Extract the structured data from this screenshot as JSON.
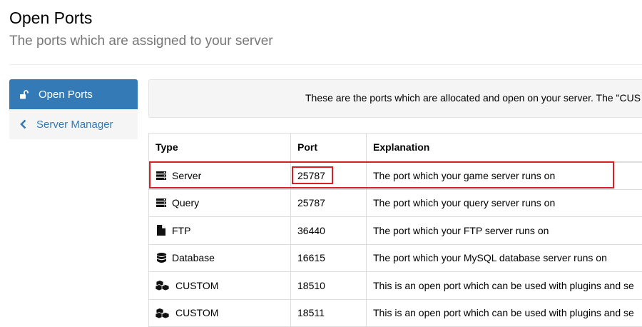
{
  "header": {
    "title": "Open Ports",
    "subtitle": "The ports which are assigned to your server"
  },
  "sidebar": {
    "items": [
      {
        "label": "Open Ports",
        "icon": "unlock-icon",
        "active": true
      },
      {
        "label": "Server Manager",
        "icon": "chevron-left-icon",
        "active": false
      }
    ]
  },
  "info": {
    "text": "These are the ports which are allocated and open on your server. The \"CUS"
  },
  "table": {
    "headers": {
      "type": "Type",
      "port": "Port",
      "explanation": "Explanation"
    },
    "rows": [
      {
        "icon": "server-icon",
        "type": "Server",
        "port": "25787",
        "explanation": "The port which your game server runs on"
      },
      {
        "icon": "server-icon",
        "type": "Query",
        "port": "25787",
        "explanation": "The port which your query server runs on"
      },
      {
        "icon": "file-icon",
        "type": "FTP",
        "port": "36440",
        "explanation": "The port which your FTP server runs on"
      },
      {
        "icon": "database-icon",
        "type": "Database",
        "port": "16615",
        "explanation": "The port which your MySQL database server runs on"
      },
      {
        "icon": "cubes-icon",
        "type": "CUSTOM",
        "port": "18510",
        "explanation": "This is an open port which can be used with plugins and se"
      },
      {
        "icon": "cubes-icon",
        "type": "CUSTOM",
        "port": "18511",
        "explanation": "This is an open port which can be used with plugins and se"
      }
    ]
  },
  "colors": {
    "primary": "#337ab7",
    "highlight": "#d81f26",
    "sidebar_bg": "#f5f5f5"
  }
}
